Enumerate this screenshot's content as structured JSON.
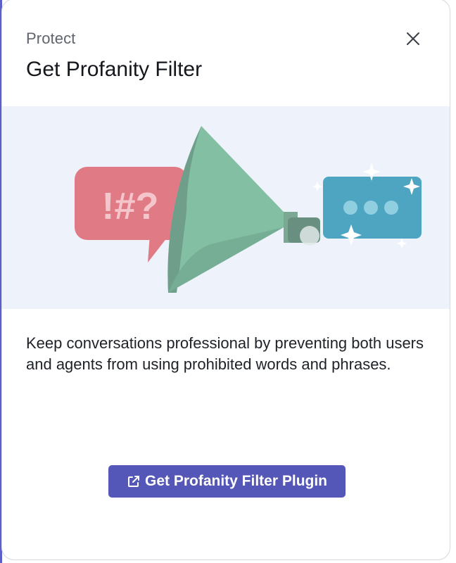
{
  "header": {
    "eyebrow": "Protect",
    "title": "Get Profanity Filter"
  },
  "hero": {
    "illustration": "profanity-funnel-illustration",
    "profanity_glyphs": "!#?",
    "colors": {
      "background": "#eef3fb",
      "profane_bubble": "#e07b86",
      "funnel": "#82bfa3",
      "clean_bubble": "#4ea5c2"
    }
  },
  "body": {
    "description": "Keep conversations professional by preventing both users and agents from using prohibited words and phrases."
  },
  "cta": {
    "label": "Get Profanity Filter Plugin",
    "icon": "external-link-icon",
    "color": "#5457b7"
  },
  "controls": {
    "close_icon": "close-icon"
  }
}
